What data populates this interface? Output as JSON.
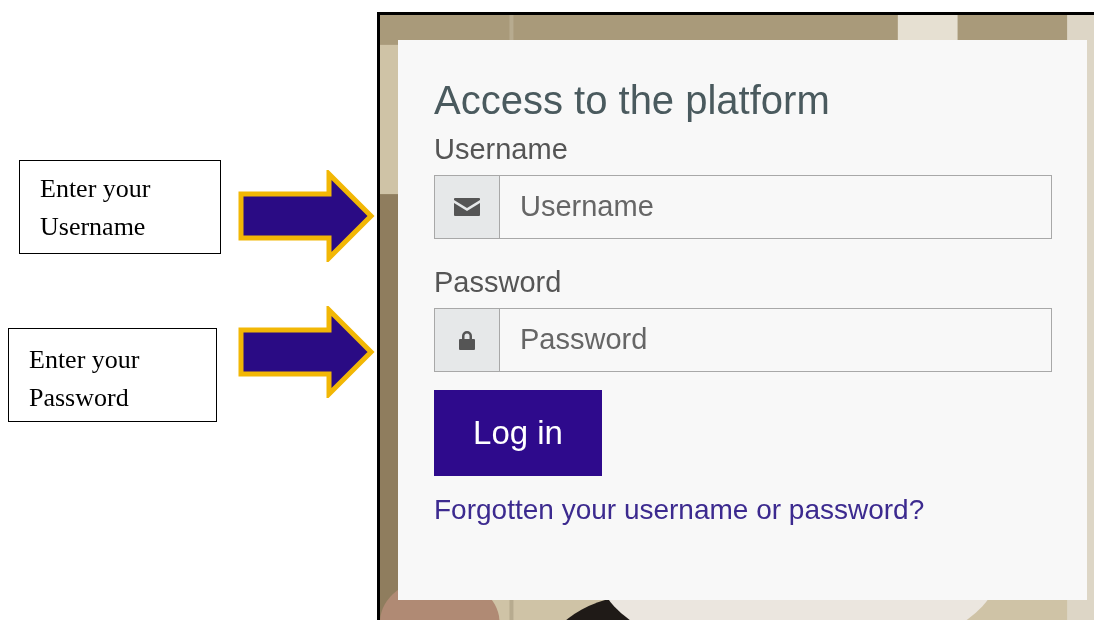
{
  "annotations": [
    {
      "text": "Enter your Username"
    },
    {
      "text": "Enter your Password"
    }
  ],
  "login": {
    "title": "Access to the platform",
    "fields": [
      {
        "kind": "username",
        "label": "Username",
        "placeholder": "Username"
      },
      {
        "kind": "password",
        "label": "Password",
        "placeholder": "Password"
      }
    ],
    "button": "Log in",
    "link": "Forgotten your username or password?"
  }
}
